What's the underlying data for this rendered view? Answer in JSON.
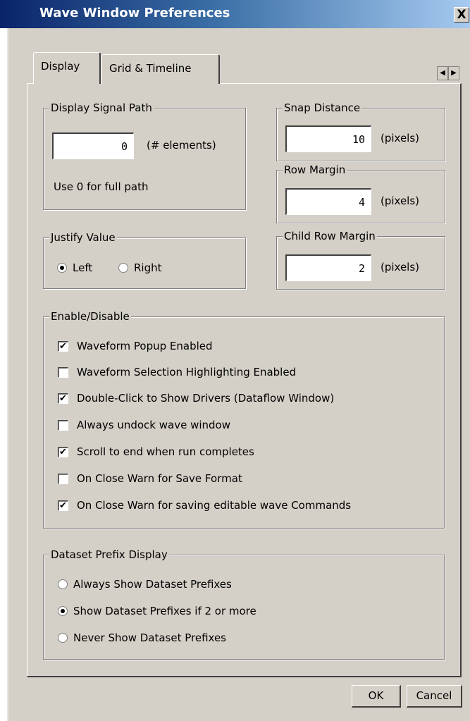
{
  "window": {
    "title": "Wave Window Preferences",
    "close_glyph": "X"
  },
  "tabs": [
    {
      "label": "Display",
      "selected": true
    },
    {
      "label": "Grid & Timeline",
      "selected": false
    }
  ],
  "tab_scroll": {
    "left_glyph": "◀",
    "right_glyph": "▶"
  },
  "display_signal_path": {
    "legend": "Display Signal Path",
    "value": "0",
    "unit": "(# elements)",
    "hint": "Use 0 for full path"
  },
  "snap_distance": {
    "legend": "Snap Distance",
    "value": "10",
    "unit": "(pixels)"
  },
  "row_margin": {
    "legend": "Row Margin",
    "value": "4",
    "unit": "(pixels)"
  },
  "child_row_margin": {
    "legend": "Child Row Margin",
    "value": "2",
    "unit": "(pixels)"
  },
  "justify_value": {
    "legend": "Justify Value",
    "options": [
      {
        "label": "Left",
        "selected": true
      },
      {
        "label": "Right",
        "selected": false
      }
    ]
  },
  "enable_disable": {
    "legend": "Enable/Disable",
    "items": [
      {
        "label": "Waveform Popup Enabled",
        "checked": true
      },
      {
        "label": "Waveform Selection Highlighting Enabled",
        "checked": false
      },
      {
        "label": "Double-Click to Show Drivers (Dataflow Window)",
        "checked": true
      },
      {
        "label": "Always undock wave window",
        "checked": false
      },
      {
        "label": "Scroll to end when run completes",
        "checked": true
      },
      {
        "label": "On Close Warn for Save Format",
        "checked": false
      },
      {
        "label": "On Close Warn for saving editable wave Commands",
        "checked": true
      }
    ]
  },
  "dataset_prefix": {
    "legend": "Dataset Prefix Display",
    "options": [
      {
        "label": "Always Show Dataset Prefixes",
        "selected": false
      },
      {
        "label": "Show Dataset Prefixes if 2 or more",
        "selected": true
      },
      {
        "label": "Never Show Dataset Prefixes",
        "selected": false
      }
    ]
  },
  "buttons": {
    "ok": "OK",
    "cancel": "Cancel"
  },
  "check_glyph": "✔"
}
